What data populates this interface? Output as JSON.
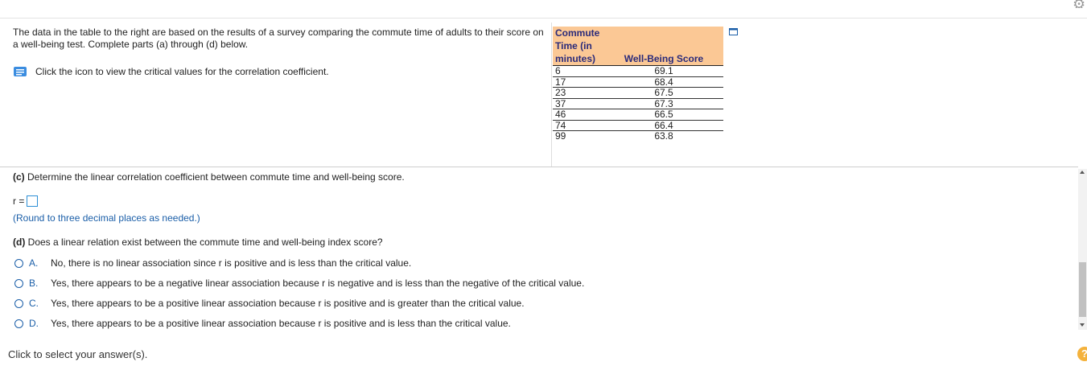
{
  "intro_text": "The data in the table to the right are based on the results of a survey comparing the commute time of adults to their score on a well-being test. Complete parts (a) through (d) below.",
  "hint": {
    "text": "Click the icon to view the critical values for the correlation coefficient.",
    "icon": "book-icon"
  },
  "table": {
    "headers": [
      "Commute Time (in minutes)",
      "Well-Being Score"
    ],
    "rows": [
      [
        "6",
        "69.1"
      ],
      [
        "17",
        "68.4"
      ],
      [
        "23",
        "67.5"
      ],
      [
        "37",
        "67.3"
      ],
      [
        "46",
        "66.5"
      ],
      [
        "74",
        "66.4"
      ],
      [
        "99",
        "63.8"
      ]
    ]
  },
  "part_c": {
    "label": "(c)",
    "question": "Determine the linear correlation coefficient between commute time and well-being score.",
    "r_label": "r =",
    "r_value": "",
    "round_note": "(Round to three decimal places as needed.)"
  },
  "part_d": {
    "label": "(d)",
    "question": "Does a linear relation exist between the commute time and well-being index score?",
    "options": [
      {
        "letter": "A.",
        "text": "No, there is no linear association since r is positive and is less than the critical value."
      },
      {
        "letter": "B.",
        "text": "Yes, there appears to be a negative linear association because r is negative and is less than the negative of the critical value."
      },
      {
        "letter": "C.",
        "text": "Yes, there appears to be a positive linear association because r is positive and is greater than the critical value."
      },
      {
        "letter": "D.",
        "text": "Yes, there appears to be a positive linear association because r is positive and is less than the critical value."
      }
    ]
  },
  "footer": "Click to select your answer(s).",
  "help_symbol": "?",
  "colors": {
    "header_bg": "#fbc895",
    "accent": "#1a5ea8",
    "input_border": "#2d8fd6",
    "help_bg": "#f4b23c"
  }
}
